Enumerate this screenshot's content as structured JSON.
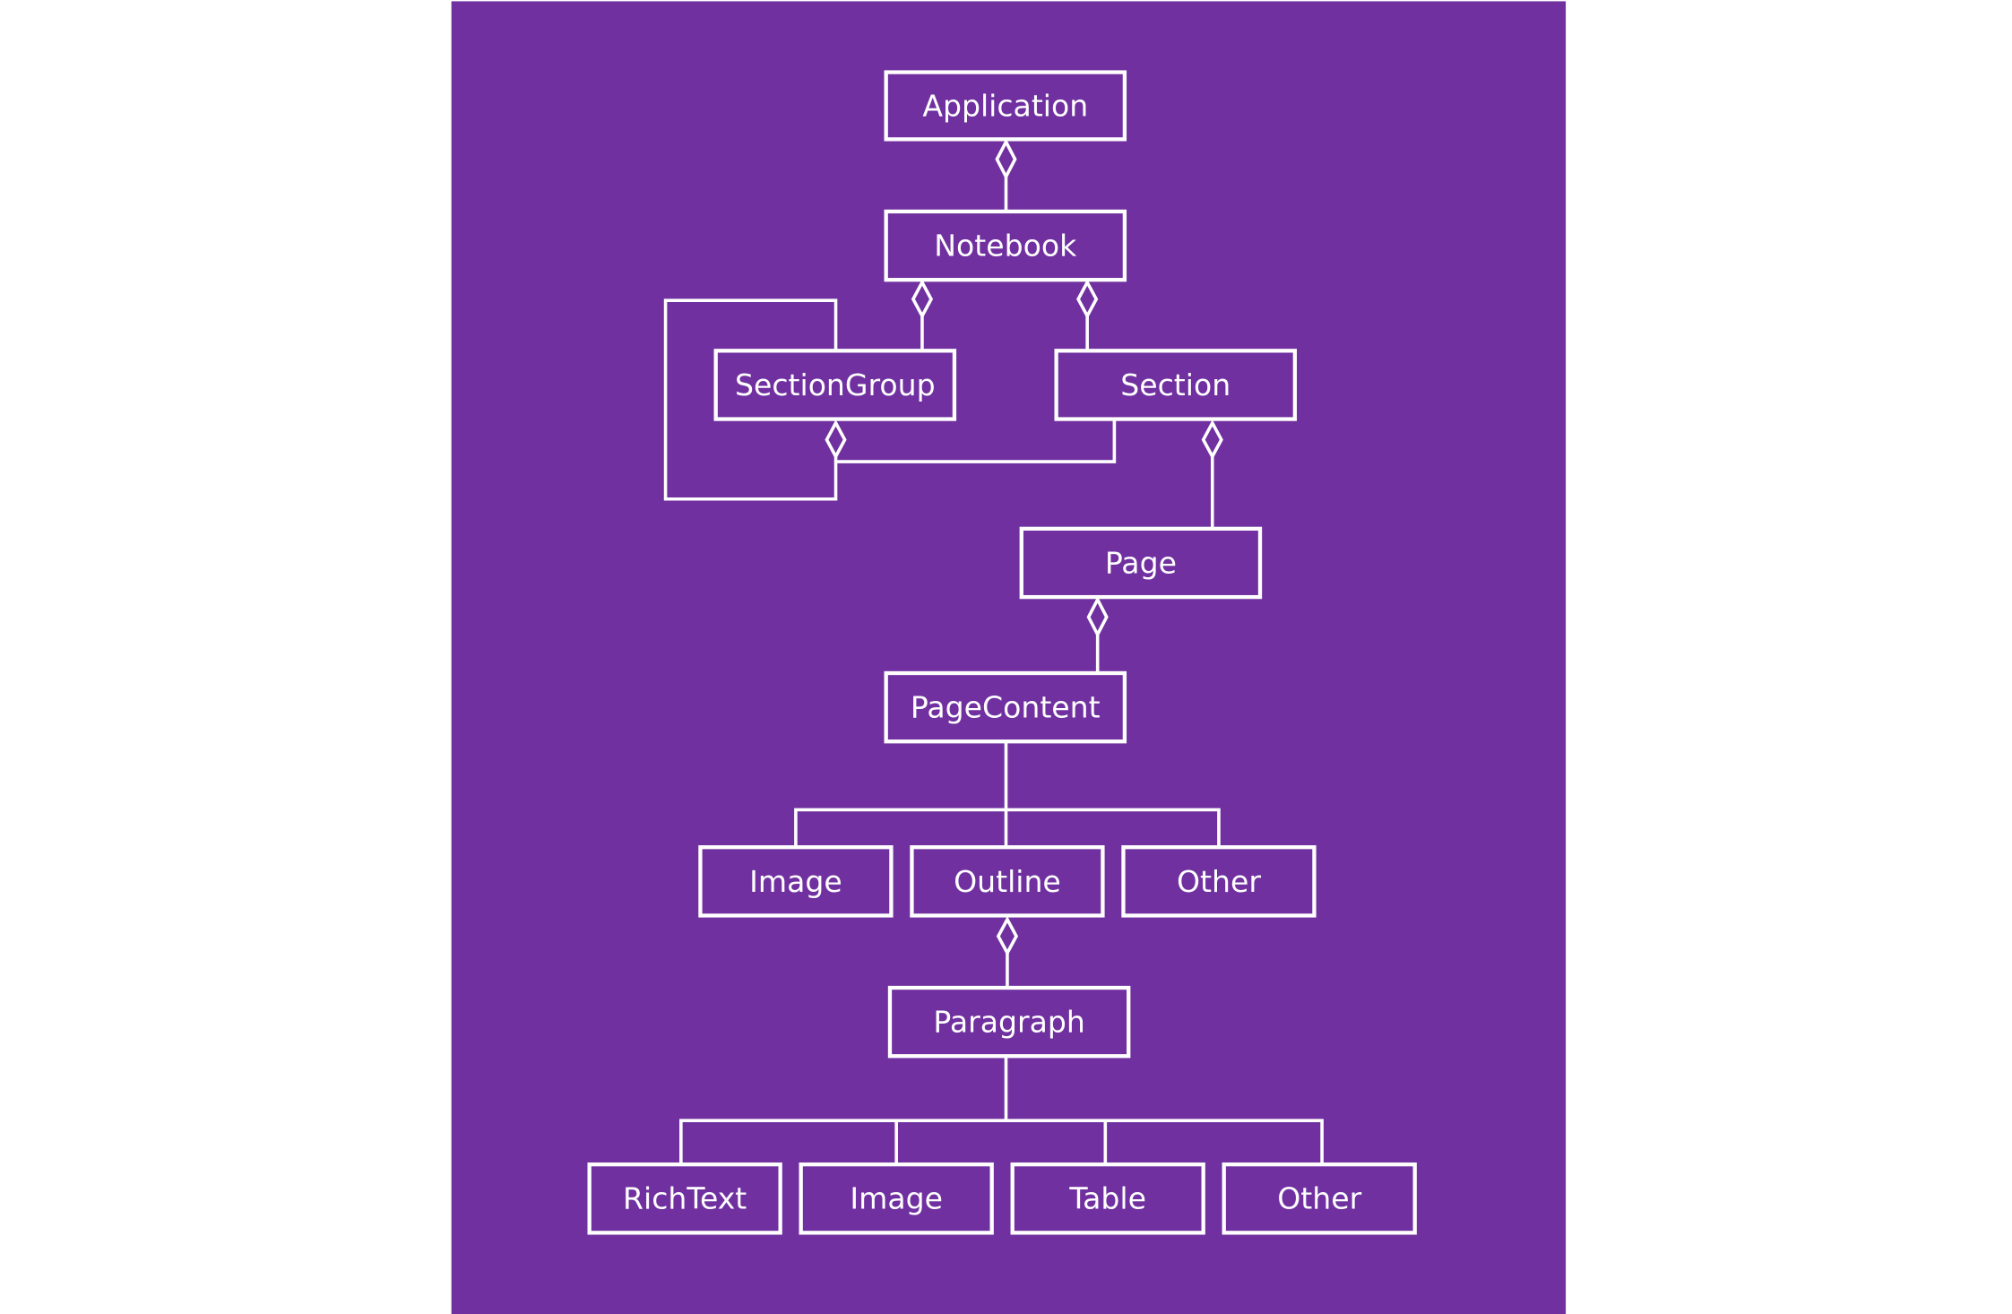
{
  "colors": {
    "background": "#7030A0",
    "stroke": "#ffffff",
    "page": "#ffffff"
  },
  "nodes": {
    "application": "Application",
    "notebook": "Notebook",
    "sectiongroup": "SectionGroup",
    "section": "Section",
    "page": "Page",
    "pagecontent": "PageContent",
    "image1": "Image",
    "outline": "Outline",
    "other1": "Other",
    "paragraph": "Paragraph",
    "richtext": "RichText",
    "image2": "Image",
    "table": "Table",
    "other2": "Other"
  },
  "relations": [
    {
      "from": "application",
      "to": "notebook",
      "type": "aggregation"
    },
    {
      "from": "notebook",
      "to": "sectiongroup",
      "type": "aggregation"
    },
    {
      "from": "notebook",
      "to": "section",
      "type": "aggregation"
    },
    {
      "from": "sectiongroup",
      "to": "sectiongroup",
      "type": "aggregation"
    },
    {
      "from": "sectiongroup",
      "to": "section",
      "type": "aggregation"
    },
    {
      "from": "section",
      "to": "page",
      "type": "aggregation"
    },
    {
      "from": "page",
      "to": "pagecontent",
      "type": "aggregation"
    },
    {
      "from": "pagecontent",
      "to": "image1",
      "type": "generalization"
    },
    {
      "from": "pagecontent",
      "to": "outline",
      "type": "generalization"
    },
    {
      "from": "pagecontent",
      "to": "other1",
      "type": "generalization"
    },
    {
      "from": "outline",
      "to": "paragraph",
      "type": "aggregation"
    },
    {
      "from": "paragraph",
      "to": "richtext",
      "type": "generalization"
    },
    {
      "from": "paragraph",
      "to": "image2",
      "type": "generalization"
    },
    {
      "from": "paragraph",
      "to": "table",
      "type": "generalization"
    },
    {
      "from": "paragraph",
      "to": "other2",
      "type": "generalization"
    }
  ]
}
